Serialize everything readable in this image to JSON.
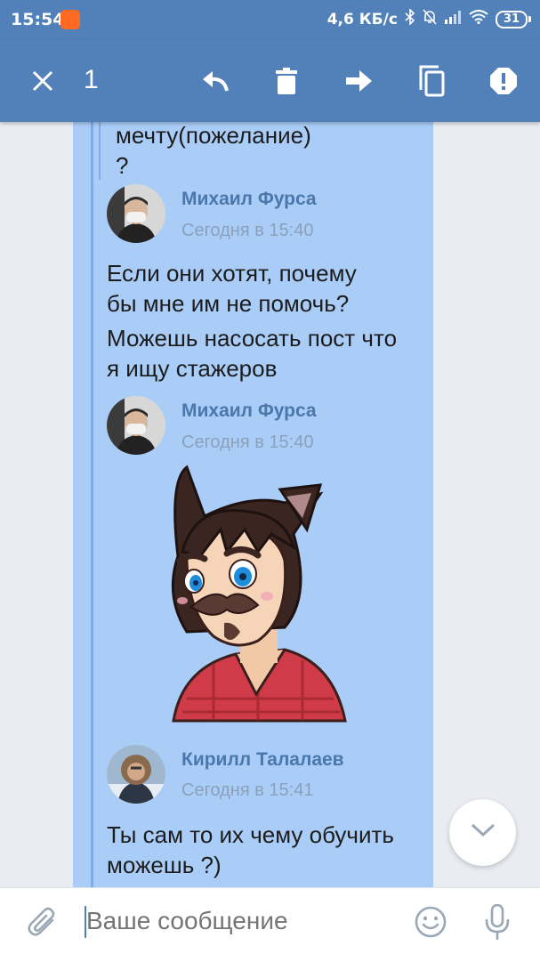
{
  "status_bar": {
    "time": "15:54",
    "network_speed": "4,6 КБ/с",
    "battery": "31"
  },
  "toolbar": {
    "selected_count": "1",
    "icons": [
      "close-icon",
      "reply-icon",
      "trash-icon",
      "forward-icon",
      "copy-icon",
      "alert-icon"
    ]
  },
  "messages": {
    "top_fragment_line1": "мечту(пожелание)",
    "top_fragment_line2": "?",
    "m1": {
      "author": "Михаил Фурса",
      "time": "Сегодня в 15:40",
      "lines": [
        "Если они хотят, почему",
        "бы мне им не помочь?",
        "Можешь насосать пост что",
        "я ищу стажеров"
      ]
    },
    "m2": {
      "author": "Михаил Фурса",
      "time": "Сегодня в 15:40",
      "sticker": "cartoon-character-sticker"
    },
    "m3": {
      "author": "Кирилл Талалаев",
      "time": "Сегодня в 15:41",
      "lines": [
        "Ты сам то их чему обучить",
        "можешь ?)"
      ]
    }
  },
  "composer": {
    "placeholder": "Ваше сообщение"
  },
  "colors": {
    "accent": "#5181b8",
    "panel": "#aacdf8",
    "name": "#4a77ac"
  }
}
